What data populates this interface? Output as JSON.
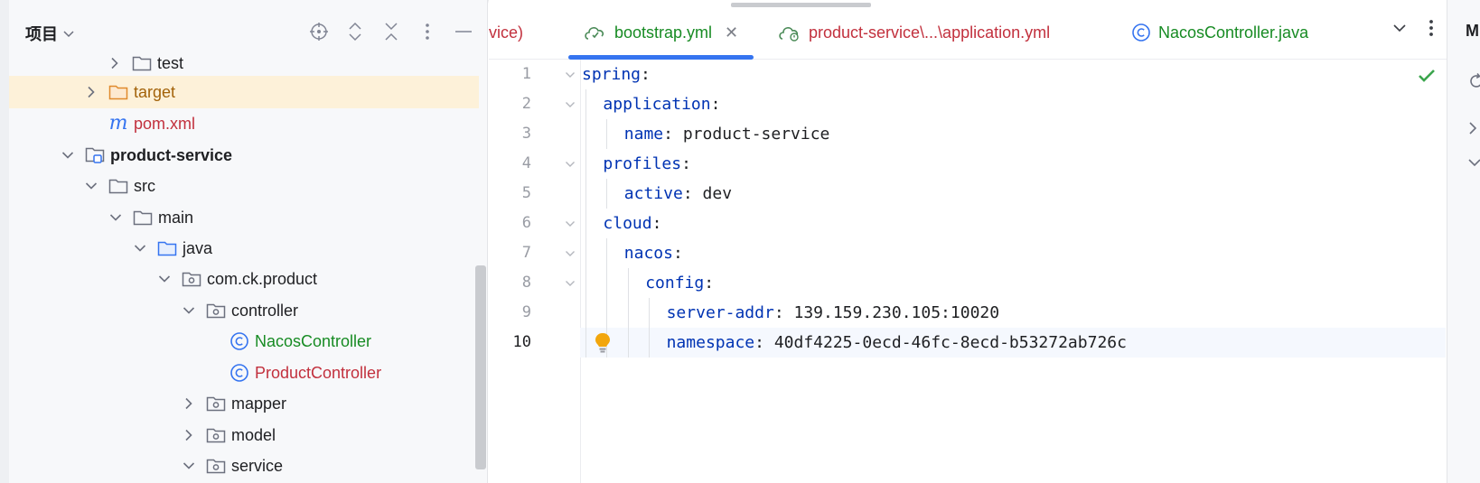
{
  "project_pane": {
    "title": "项目",
    "actions": [
      "locate-icon",
      "expand-all-icon",
      "collapse-all-icon",
      "more-vertical-icon",
      "hide-icon"
    ],
    "tree": [
      {
        "label": "test",
        "icon": "folder-icon",
        "arrow": "collapsed",
        "style": "normal",
        "partial": true
      },
      {
        "label": "target",
        "icon": "folder-excluded-icon",
        "arrow": "collapsed",
        "style": "orange",
        "selected": true
      },
      {
        "label": "pom.xml",
        "icon": "maven-icon",
        "arrow": "none",
        "style": "red"
      },
      {
        "label": "product-service",
        "icon": "module-icon",
        "arrow": "expanded",
        "style": "bold"
      },
      {
        "label": "src",
        "icon": "folder-icon",
        "arrow": "expanded",
        "style": "normal"
      },
      {
        "label": "main",
        "icon": "folder-icon",
        "arrow": "expanded",
        "style": "normal"
      },
      {
        "label": "java",
        "icon": "source-folder-icon",
        "arrow": "expanded",
        "style": "normal"
      },
      {
        "label": "com.ck.product",
        "icon": "package-icon",
        "arrow": "expanded",
        "style": "normal"
      },
      {
        "label": "controller",
        "icon": "package-icon",
        "arrow": "expanded",
        "style": "normal"
      },
      {
        "label": "NacosController",
        "icon": "class-icon",
        "arrow": "none",
        "style": "green"
      },
      {
        "label": "ProductController",
        "icon": "class-icon",
        "arrow": "none",
        "style": "red"
      },
      {
        "label": "mapper",
        "icon": "package-icon",
        "arrow": "collapsed",
        "style": "normal"
      },
      {
        "label": "model",
        "icon": "package-icon",
        "arrow": "collapsed",
        "style": "normal"
      },
      {
        "label": "service",
        "icon": "package-icon",
        "arrow": "expanded",
        "style": "normal",
        "partial": true
      }
    ]
  },
  "editor": {
    "tabs": [
      {
        "label": "vice)",
        "icon": "",
        "color": "#c2303d"
      },
      {
        "label": "bootstrap.yml",
        "icon": "yaml-icon",
        "color": "#178b23",
        "active": true,
        "closable": true
      },
      {
        "label": "product-service\\...\\application.yml",
        "icon": "yaml-icon",
        "color": "#c2303d"
      },
      {
        "label": "NacosController.java",
        "icon": "class-icon",
        "color": "#178b23"
      }
    ],
    "tab_tools": [
      "chevron-down-icon",
      "more-vertical-icon"
    ],
    "current_line": 10,
    "lines": [
      {
        "num": "1",
        "indent": 0,
        "key": "spring",
        "value": ""
      },
      {
        "num": "2",
        "indent": 1,
        "key": "application",
        "value": ""
      },
      {
        "num": "3",
        "indent": 2,
        "key": "name",
        "value": "product-service"
      },
      {
        "num": "4",
        "indent": 1,
        "key": "profiles",
        "value": ""
      },
      {
        "num": "5",
        "indent": 2,
        "key": "active",
        "value": "dev"
      },
      {
        "num": "6",
        "indent": 1,
        "key": "cloud",
        "value": ""
      },
      {
        "num": "7",
        "indent": 2,
        "key": "nacos",
        "value": ""
      },
      {
        "num": "8",
        "indent": 3,
        "key": "config",
        "value": ""
      },
      {
        "num": "9",
        "indent": 4,
        "key": "server-addr",
        "value": "139.159.230.105:10020"
      },
      {
        "num": "10",
        "indent": 4,
        "key": "namespace",
        "value": "40df4225-0ecd-46fc-8ecd-b53272ab726c"
      }
    ]
  },
  "right_strip": {
    "title": "M"
  },
  "colors": {
    "accent": "#3574f0",
    "keyword": "#0033b3",
    "modified": "#178b23",
    "error": "#c2303d",
    "selected": "#fdf1d9"
  }
}
